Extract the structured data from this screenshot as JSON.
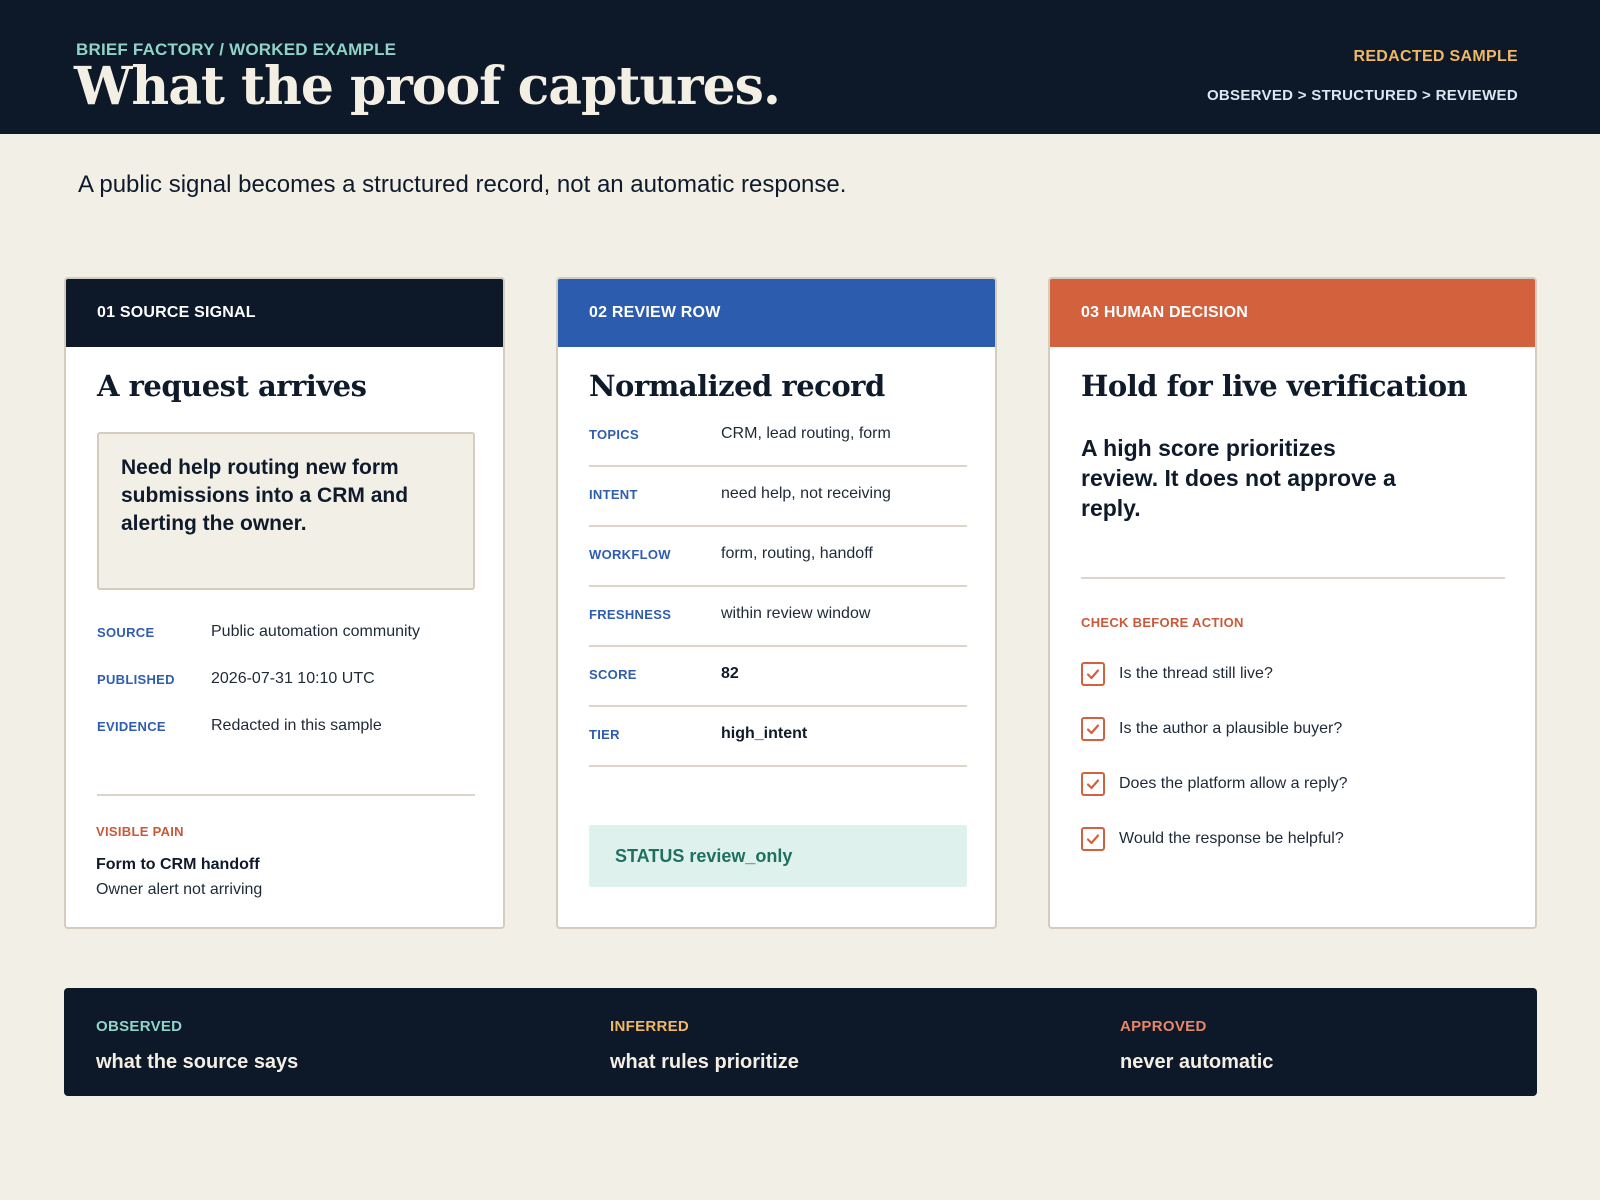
{
  "header": {
    "kicker": "BRIEF FACTORY / WORKED EXAMPLE",
    "title": "What the proof captures.",
    "tag": "REDACTED SAMPLE",
    "pipeline": "OBSERVED > STRUCTURED > REVIEWED"
  },
  "lede": "A public signal becomes a structured record, not an automatic response.",
  "source": {
    "head": "01 SOURCE SIGNAL",
    "title": "A request arrives",
    "quote": "Need help routing new form submissions into a CRM and alerting the owner.",
    "meta": [
      {
        "key": "SOURCE",
        "value": "Public automation community"
      },
      {
        "key": "PUBLISHED",
        "value": "2026-07-31 10:10 UTC"
      },
      {
        "key": "EVIDENCE",
        "value": "Redacted in this sample"
      }
    ],
    "pain_label": "VISIBLE PAIN",
    "pain_primary": "Form to CRM handoff",
    "pain_secondary": "Owner alert not arriving"
  },
  "review": {
    "head": "02 REVIEW ROW",
    "title": "Normalized record",
    "rows": [
      {
        "key": "TOPICS",
        "value": "CRM, lead routing, form"
      },
      {
        "key": "INTENT",
        "value": "need help, not receiving"
      },
      {
        "key": "WORKFLOW",
        "value": "form, routing, handoff"
      },
      {
        "key": "FRESHNESS",
        "value": "within review window"
      },
      {
        "key": "SCORE",
        "value": "82"
      },
      {
        "key": "TIER",
        "value": "high_intent"
      }
    ],
    "status": "STATUS review_only"
  },
  "decision": {
    "head": "03 HUMAN DECISION",
    "title": "Hold for live verification",
    "callout": "A high score prioritizes review. It does not approve a reply.",
    "check_label": "CHECK BEFORE ACTION",
    "checks": [
      {
        "text": "Is the thread still live?",
        "icon": "check-icon",
        "checked": true
      },
      {
        "text": "Is the author a plausible buyer?",
        "icon": "check-icon",
        "checked": true
      },
      {
        "text": "Does the platform allow a reply?",
        "icon": "check-icon",
        "checked": true
      },
      {
        "text": "Would the response be helpful?",
        "icon": "check-icon",
        "checked": true
      }
    ]
  },
  "band": [
    {
      "label": "OBSERVED",
      "text": "what the source says",
      "color": "#8fd3c9"
    },
    {
      "label": "INFERRED",
      "text": "what rules prioritize",
      "color": "#f0b866"
    },
    {
      "label": "APPROVED",
      "text": "never automatic",
      "color": "#e8866a"
    }
  ],
  "colors": {
    "navy": "#0d1828",
    "blue": "#2c5cad",
    "orange": "#d3613d",
    "teal": "#8fd3c9",
    "gold": "#f0b866",
    "background": "#f2efe7"
  }
}
